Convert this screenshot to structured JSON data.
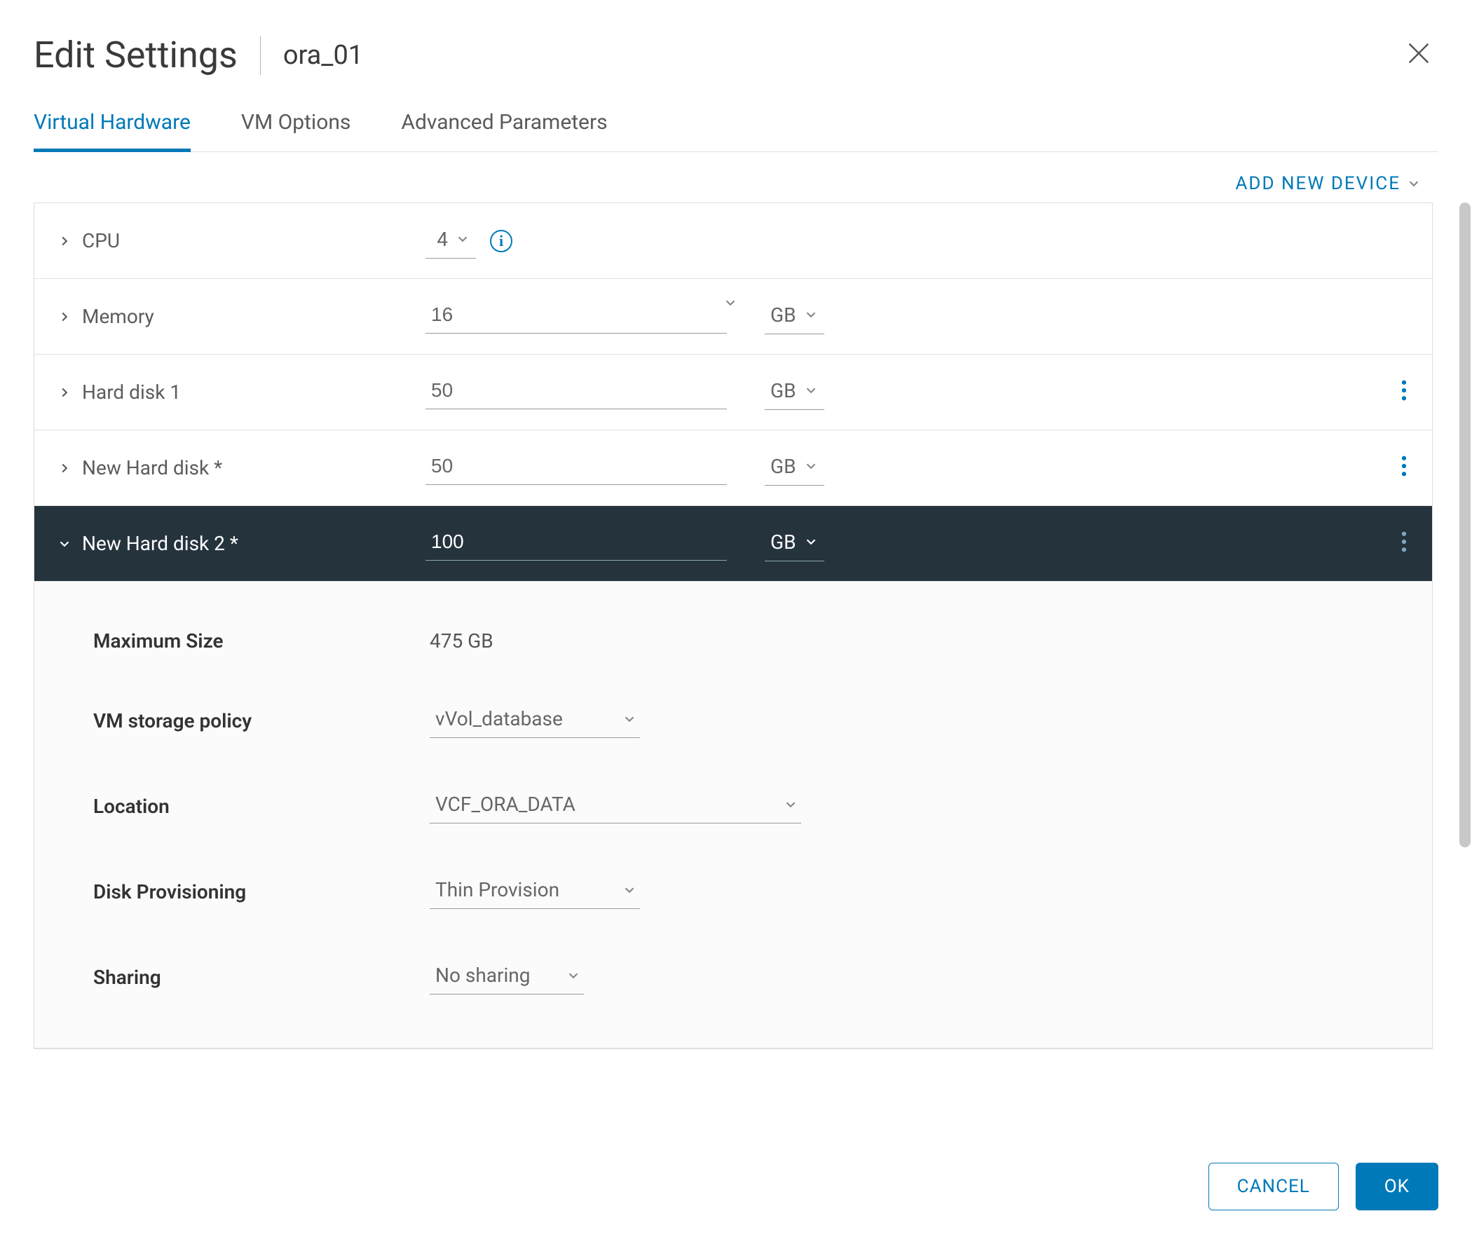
{
  "header": {
    "title": "Edit Settings",
    "subtitle": "ora_01"
  },
  "tabs": [
    {
      "label": "Virtual Hardware",
      "active": true
    },
    {
      "label": "VM Options",
      "active": false
    },
    {
      "label": "Advanced Parameters",
      "active": false
    }
  ],
  "addDevice": "ADD NEW DEVICE",
  "rows": {
    "cpu": {
      "label": "CPU",
      "value": "4"
    },
    "memory": {
      "label": "Memory",
      "value": "16",
      "unit": "GB"
    },
    "hd1": {
      "label": "Hard disk 1",
      "value": "50",
      "unit": "GB"
    },
    "nhd": {
      "label": "New Hard disk *",
      "value": "50",
      "unit": "GB"
    },
    "nhd2": {
      "label": "New Hard disk 2 *",
      "value": "100",
      "unit": "GB"
    }
  },
  "detail": {
    "maxSize": {
      "label": "Maximum Size",
      "value": "475 GB"
    },
    "policy": {
      "label": "VM storage policy",
      "value": "vVol_database"
    },
    "location": {
      "label": "Location",
      "value": "VCF_ORA_DATA"
    },
    "prov": {
      "label": "Disk Provisioning",
      "value": "Thin Provision"
    },
    "sharing": {
      "label": "Sharing",
      "value": "No sharing"
    }
  },
  "buttons": {
    "cancel": "CANCEL",
    "ok": "OK"
  }
}
